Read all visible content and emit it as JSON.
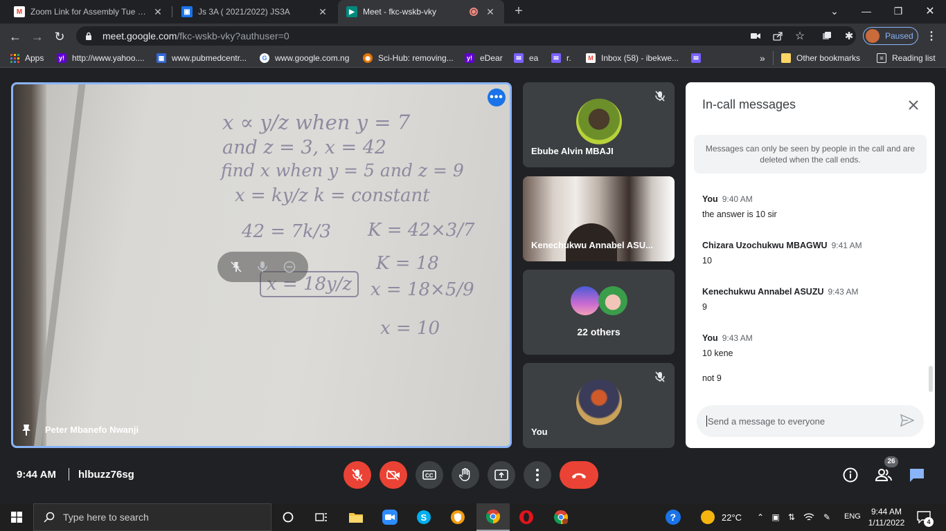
{
  "browser": {
    "tabs": [
      {
        "title": "Zoom Link for Assembly Tue - Th",
        "icon": "gmail-icon",
        "color": "#ea4335"
      },
      {
        "title": "Js 3A ( 2021/2022) JS3A",
        "icon": "classroom-icon",
        "color": "#1a73e8"
      },
      {
        "title": "Meet - fkc-wskb-vky",
        "icon": "meet-icon",
        "color": "#00897b"
      }
    ],
    "url_host": "meet.google.com",
    "url_path": "/fkc-wskb-vky?authuser=0",
    "profile_label": "Paused",
    "bookmarks": [
      {
        "label": "Apps",
        "icon": "apps-grid-icon",
        "color": "#ea4335"
      },
      {
        "label": "http://www.yahoo....",
        "icon": "yahoo-icon",
        "color": "#6001d2"
      },
      {
        "label": "www.pubmedcentr...",
        "icon": "pubmed-icon",
        "color": "#3367d6"
      },
      {
        "label": "www.google.com.ng",
        "icon": "google-icon",
        "color": "#4285f4"
      },
      {
        "label": "Sci-Hub: removing...",
        "icon": "scihub-icon",
        "color": "#e37400"
      },
      {
        "label": "eDear",
        "icon": "yahoo-icon",
        "color": "#6001d2"
      },
      {
        "label": "ea",
        "icon": "mail-icon",
        "color": "#7b61ff"
      },
      {
        "label": "r.",
        "icon": "mail-icon",
        "color": "#7b61ff"
      },
      {
        "label": "Inbox (58) - ibekwe...",
        "icon": "gmail-icon",
        "color": "#ea4335"
      },
      {
        "label": "",
        "icon": "mail-icon",
        "color": "#7b61ff"
      }
    ],
    "bookmark_overflow": "»",
    "other_bookmarks": "Other bookmarks",
    "reading_list": "Reading list"
  },
  "meet": {
    "main_speaker": "Peter Mbanefo Nwanji",
    "participants": [
      {
        "name": "Ebube Alvin MBAJI",
        "muted": true
      },
      {
        "name": "Kenechukwu Annabel ASU...",
        "muted": false
      },
      {
        "name": "22 others",
        "muted": false
      },
      {
        "name": "You",
        "muted": true
      }
    ],
    "whiteboard": [
      "x ∝ y/z  when y = 7",
      "and z = 3,  x = 42",
      "find x when y = 5 and z = 9",
      "x =  ky/z     k = constant",
      "42 = 7k/3",
      "K = 42×3/7",
      "K = 18",
      "x = 18y/z",
      "x = 18×5/9",
      "x = 10"
    ],
    "time": "9:44 AM",
    "meeting_code": "hlbuzz76sg",
    "participant_count": "26",
    "colors": {
      "accent": "#8ab4f8",
      "danger": "#ea4335",
      "tile": "#3c4043"
    }
  },
  "chat": {
    "title": "In-call messages",
    "notice": "Messages can only be seen by people in the call and are deleted when the call ends.",
    "messages": [
      {
        "from": "You",
        "time": "9:40 AM",
        "lines": [
          "the answer is 10 sir"
        ]
      },
      {
        "from": "Chizara Uzochukwu MBAGWU",
        "time": "9:41 AM",
        "lines": [
          "10"
        ]
      },
      {
        "from": "Kenechukwu Annabel ASUZU",
        "time": "9:43 AM",
        "lines": [
          "9"
        ]
      },
      {
        "from": "You",
        "time": "9:43 AM",
        "lines": [
          "10 kene",
          "not 9"
        ]
      }
    ],
    "input_placeholder": "Send a message to everyone"
  },
  "taskbar": {
    "search_placeholder": "Type here to search",
    "temperature": "22°C",
    "language": "ENG",
    "time": "9:44 AM",
    "date": "1/11/2022",
    "notifications": "4"
  }
}
